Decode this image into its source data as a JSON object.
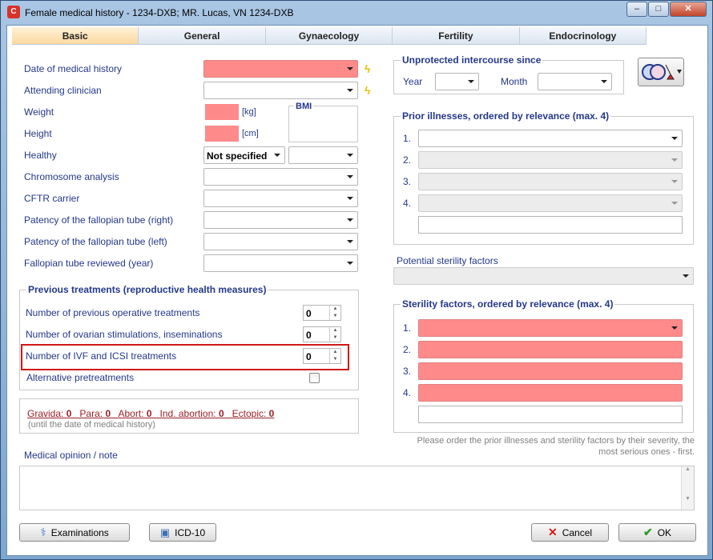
{
  "window": {
    "title": "Female medical history - 1234-DXB; MR. Lucas, VN 1234-DXB",
    "app_icon_glyph": "C",
    "controls": {
      "minimize": "–",
      "maximize": "□",
      "close": "✕"
    }
  },
  "tabs": [
    {
      "label": "Basic",
      "active": true
    },
    {
      "label": "General",
      "active": false
    },
    {
      "label": "Gynaecology",
      "active": false
    },
    {
      "label": "Fertility",
      "active": false
    },
    {
      "label": "Endocrinology",
      "active": false
    }
  ],
  "left": {
    "date_label": "Date of medical history",
    "clinician_label": "Attending clinician",
    "weight_label": "Weight",
    "weight_unit": "[kg]",
    "height_label": "Height",
    "height_unit": "[cm]",
    "bmi_label": "BMI",
    "healthy_label": "Healthy",
    "healthy_value": "Not specified",
    "chromosome_label": "Chromosome analysis",
    "cftr_label": "CFTR carrier",
    "patency_right_label": "Patency of the fallopian tube (right)",
    "patency_left_label": "Patency of the fallopian tube (left)",
    "tube_reviewed_label": "Fallopian tube reviewed (year)"
  },
  "treatments": {
    "legend": "Previous treatments (reproductive health measures)",
    "operative_label": "Number of previous operative treatments",
    "operative_value": "0",
    "ovarian_label": "Number of ovarian stimulations, inseminations",
    "ovarian_value": "0",
    "ivf_label": "Number of IVF and ICSI treatments",
    "ivf_value": "0",
    "alternative_label": "Alternative pretreatments"
  },
  "obstetric": {
    "gravida_label": "Gravida:",
    "gravida_value": "0",
    "para_label": "Para:",
    "para_value": "0",
    "abort_label": "Abort:",
    "abort_value": "0",
    "ind_label": "Ind. abortion:",
    "ind_value": "0",
    "ectopic_label": "Ectopic:",
    "ectopic_value": "0",
    "subtitle": "(until the date of medical history)"
  },
  "intercourse": {
    "legend": "Unprotected intercourse since",
    "year_label": "Year",
    "month_label": "Month"
  },
  "prior_illnesses": {
    "legend": "Prior illnesses, ordered by relevance (max. 4)",
    "numbers": [
      "1.",
      "2.",
      "3.",
      "4."
    ]
  },
  "potential_label": "Potential sterility factors",
  "sterility": {
    "legend": "Sterility factors, ordered by relevance (max. 4)",
    "numbers": [
      "1.",
      "2.",
      "3.",
      "4."
    ]
  },
  "order_note": "Please order the prior illnesses and sterility factors by their severity, the most serious ones - first.",
  "medical_note_label": "Medical opinion / note",
  "buttons": {
    "examinations": "Examinations",
    "icd": "ICD-10",
    "cancel": "Cancel",
    "ok": "OK"
  },
  "colors": {
    "required": "#ff8a8a",
    "label": "#24388a",
    "highlight": "#d01818",
    "active_tab": "#fbd9a1"
  }
}
